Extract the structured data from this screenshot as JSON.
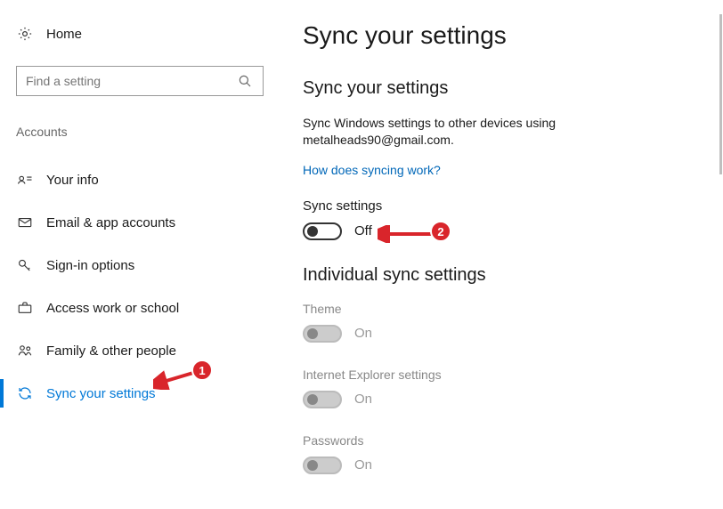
{
  "sidebar": {
    "home": "Home",
    "search_placeholder": "Find a setting",
    "section": "Accounts",
    "items": [
      {
        "label": "Your info"
      },
      {
        "label": "Email & app accounts"
      },
      {
        "label": "Sign-in options"
      },
      {
        "label": "Access work or school"
      },
      {
        "label": "Family & other people"
      },
      {
        "label": "Sync your settings"
      }
    ]
  },
  "main": {
    "title": "Sync your settings",
    "subtitle": "Sync your settings",
    "description": "Sync Windows settings to other devices using metalheads90@gmail.com.",
    "link": "How does syncing work?",
    "sync_label": "Sync settings",
    "sync_state": "Off",
    "individual_title": "Individual sync settings",
    "individual": [
      {
        "label": "Theme",
        "state": "On"
      },
      {
        "label": "Internet Explorer settings",
        "state": "On"
      },
      {
        "label": "Passwords",
        "state": "On"
      }
    ]
  },
  "annotations": {
    "badge1": "1",
    "badge2": "2"
  }
}
